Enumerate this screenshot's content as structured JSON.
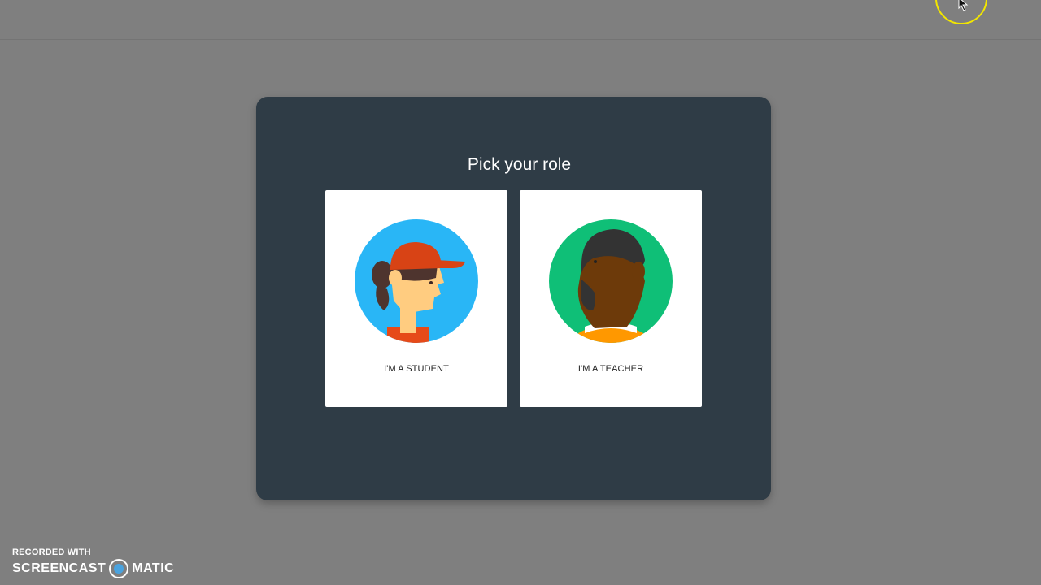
{
  "dialog": {
    "title": "Pick your role",
    "roles": [
      {
        "label": "I'M A STUDENT",
        "avatar_icon": "student-avatar-icon",
        "avatar_bg": "#29b6f6"
      },
      {
        "label": "I'M A TEACHER",
        "avatar_icon": "teacher-avatar-icon",
        "avatar_bg": "#0fbf77"
      }
    ]
  },
  "watermark": {
    "line1": "RECORDED WITH",
    "brand_left": "SCREENCAST",
    "brand_right": "MATIC"
  },
  "colors": {
    "background": "#7f7f7f",
    "dialog": "#2f3c46",
    "card": "#ffffff",
    "cursor_highlight": "#f2e600"
  }
}
